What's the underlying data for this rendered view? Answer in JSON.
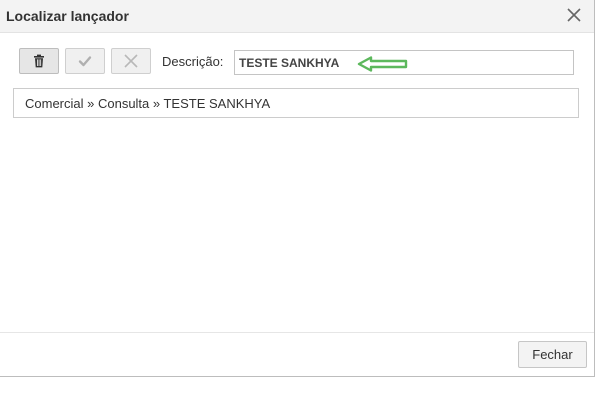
{
  "dialog": {
    "title": "Localizar lançador",
    "close_icon": "close-icon"
  },
  "toolbar": {
    "delete_icon": "trash-icon",
    "confirm_icon": "check-icon",
    "cancel_icon": "x-icon"
  },
  "description": {
    "label": "Descrição:",
    "value": "TESTE SANKHYA"
  },
  "result": {
    "path": "Comercial » Consulta » TESTE SANKHYA"
  },
  "footer": {
    "close_label": "Fechar"
  },
  "colors": {
    "annotation_arrow": "#5cb85c"
  }
}
